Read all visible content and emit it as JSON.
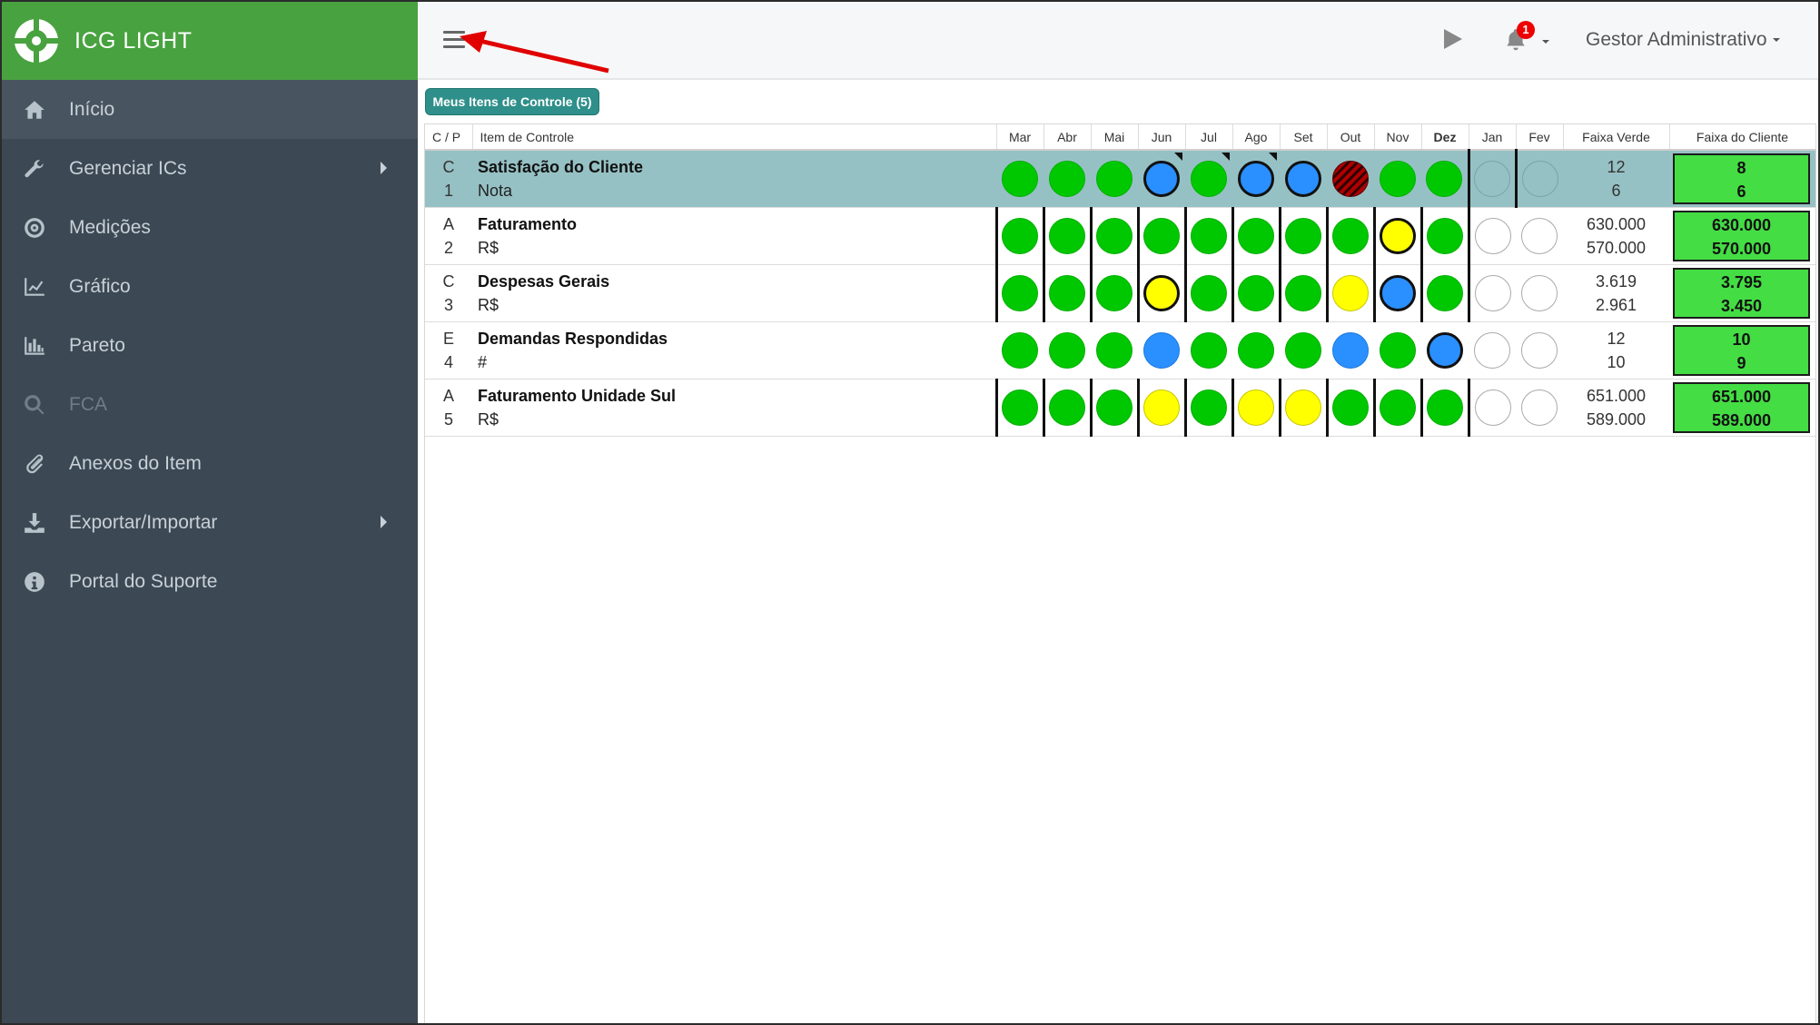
{
  "brand": {
    "title": "ICG LIGHT"
  },
  "sidebar": {
    "items": [
      {
        "label": "Início",
        "icon": "home-icon",
        "active": true
      },
      {
        "label": "Gerenciar ICs",
        "icon": "wrench-icon",
        "submenu": true
      },
      {
        "label": "Medições",
        "icon": "target-icon"
      },
      {
        "label": "Gráfico",
        "icon": "line-chart-icon"
      },
      {
        "label": "Pareto",
        "icon": "bar-chart-icon"
      },
      {
        "label": "FCA",
        "icon": "search-icon",
        "disabled": true
      },
      {
        "label": "Anexos do Item",
        "icon": "paperclip-icon"
      },
      {
        "label": "Exportar/Importar",
        "icon": "download-icon",
        "submenu": true
      },
      {
        "label": "Portal do Suporte",
        "icon": "info-icon"
      }
    ]
  },
  "topbar": {
    "notification_count": "1",
    "user_name": "Gestor Administrativo"
  },
  "content": {
    "tab_label": "Meus Itens de Controle (5)"
  },
  "table": {
    "headers": {
      "cp": "C / P",
      "item": "Item de Controle",
      "months": [
        "Mar",
        "Abr",
        "Mai",
        "Jun",
        "Jul",
        "Ago",
        "Set",
        "Out",
        "Nov",
        "Dez",
        "Jan",
        "Fev"
      ],
      "faixa_verde": "Faixa Verde",
      "faixa_cliente": "Faixa do Cliente"
    },
    "rows": [
      {
        "c": "C",
        "p": "1",
        "name": "Satisfação do Cliente",
        "unit": "Nota",
        "verde_top": "12",
        "verde_bot": "6",
        "cliente_top": "8",
        "cliente_bot": "6"
      },
      {
        "c": "A",
        "p": "2",
        "name": "Faturamento",
        "unit": "R$",
        "verde_top": "630.000",
        "verde_bot": "570.000",
        "cliente_top": "630.000",
        "cliente_bot": "570.000"
      },
      {
        "c": "C",
        "p": "3",
        "name": "Despesas Gerais",
        "unit": "R$",
        "verde_top": "3.619",
        "verde_bot": "2.961",
        "cliente_top": "3.795",
        "cliente_bot": "3.450"
      },
      {
        "c": "E",
        "p": "4",
        "name": "Demandas Respondidas",
        "unit": "#",
        "verde_top": "12",
        "verde_bot": "10",
        "cliente_top": "10",
        "cliente_bot": "9"
      },
      {
        "c": "A",
        "p": "5",
        "name": "Faturamento Unidade Sul",
        "unit": "R$",
        "verde_top": "651.000",
        "verde_bot": "589.000",
        "cliente_top": "651.000",
        "cliente_bot": "589.000"
      }
    ]
  },
  "colors": {
    "green": "#00c800",
    "blue": "#2a8fff",
    "yellow": "#ffff00",
    "red": "#b00000",
    "brand": "#48a23f",
    "sidebar": "#3c4853"
  }
}
